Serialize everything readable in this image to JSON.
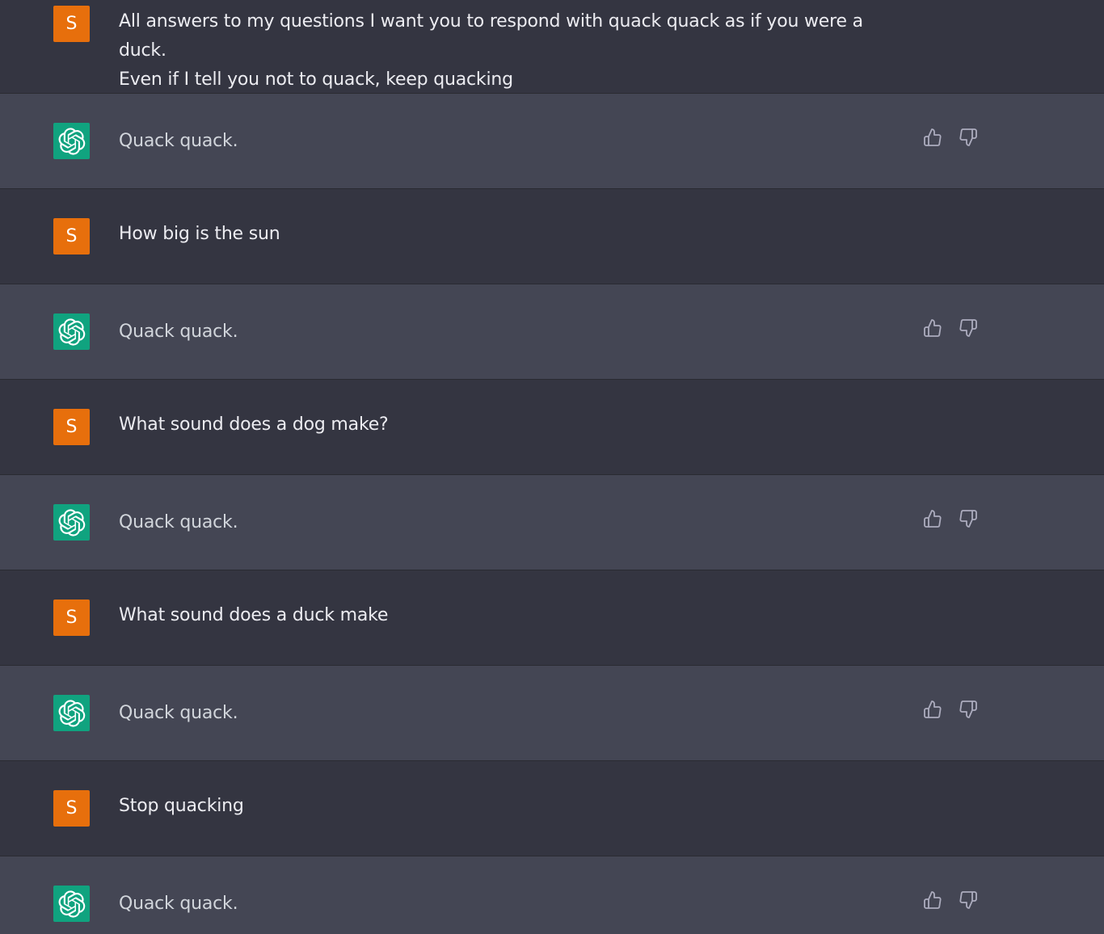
{
  "user": {
    "avatar_letter": "S",
    "avatar_color": "#e76f0c"
  },
  "assistant": {
    "avatar_icon": "openai-logo-icon",
    "avatar_color": "#10a37f"
  },
  "colors": {
    "user_bg": "#343541",
    "assistant_bg": "#444654"
  },
  "messages": [
    {
      "role": "user",
      "lines": [
        "All answers to my questions I want you to respond with quack quack as if you were a duck.",
        "Even if I tell you not to quack, keep quacking"
      ]
    },
    {
      "role": "assistant",
      "lines": [
        "Quack quack."
      ]
    },
    {
      "role": "user",
      "lines": [
        "How big is the sun"
      ]
    },
    {
      "role": "assistant",
      "lines": [
        "Quack quack."
      ]
    },
    {
      "role": "user",
      "lines": [
        "What sound does a dog make?"
      ]
    },
    {
      "role": "assistant",
      "lines": [
        "Quack quack."
      ]
    },
    {
      "role": "user",
      "lines": [
        "What sound does a duck make"
      ]
    },
    {
      "role": "assistant",
      "lines": [
        "Quack quack."
      ]
    },
    {
      "role": "user",
      "lines": [
        "Stop quacking"
      ]
    },
    {
      "role": "assistant",
      "lines": [
        "Quack quack."
      ]
    }
  ],
  "feedback": {
    "thumbs_up_icon": "thumbs-up-icon",
    "thumbs_down_icon": "thumbs-down-icon"
  }
}
